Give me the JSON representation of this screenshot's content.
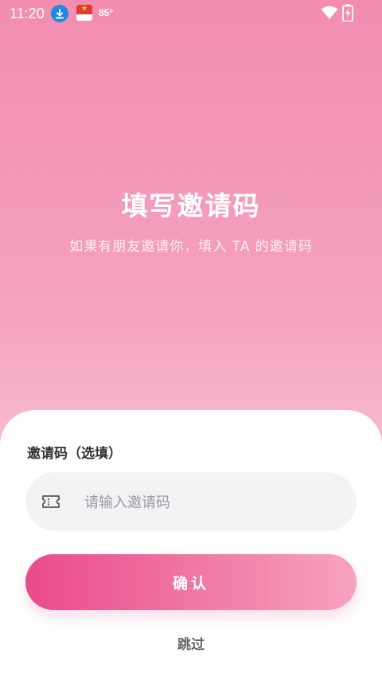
{
  "status_bar": {
    "time": "11:20",
    "temperature": "85°",
    "icons": [
      "download-icon",
      "app-notification-icon",
      "wifi-icon",
      "battery-charging-icon"
    ]
  },
  "header": {
    "title": "填写邀请码",
    "subtitle": "如果有朋友邀请你，填入 TA 的邀请码"
  },
  "form": {
    "label": "邀请码（选填）",
    "input": {
      "value": "",
      "placeholder": "请输入邀请码",
      "icon": "ticket-icon"
    },
    "confirm_label": "确认",
    "skip_label": "跳过"
  },
  "colors": {
    "background_top": "#f28db0",
    "background_bottom": "#f8c4d5",
    "button_start": "#ea4a8b",
    "button_end": "#f7a3c1"
  }
}
